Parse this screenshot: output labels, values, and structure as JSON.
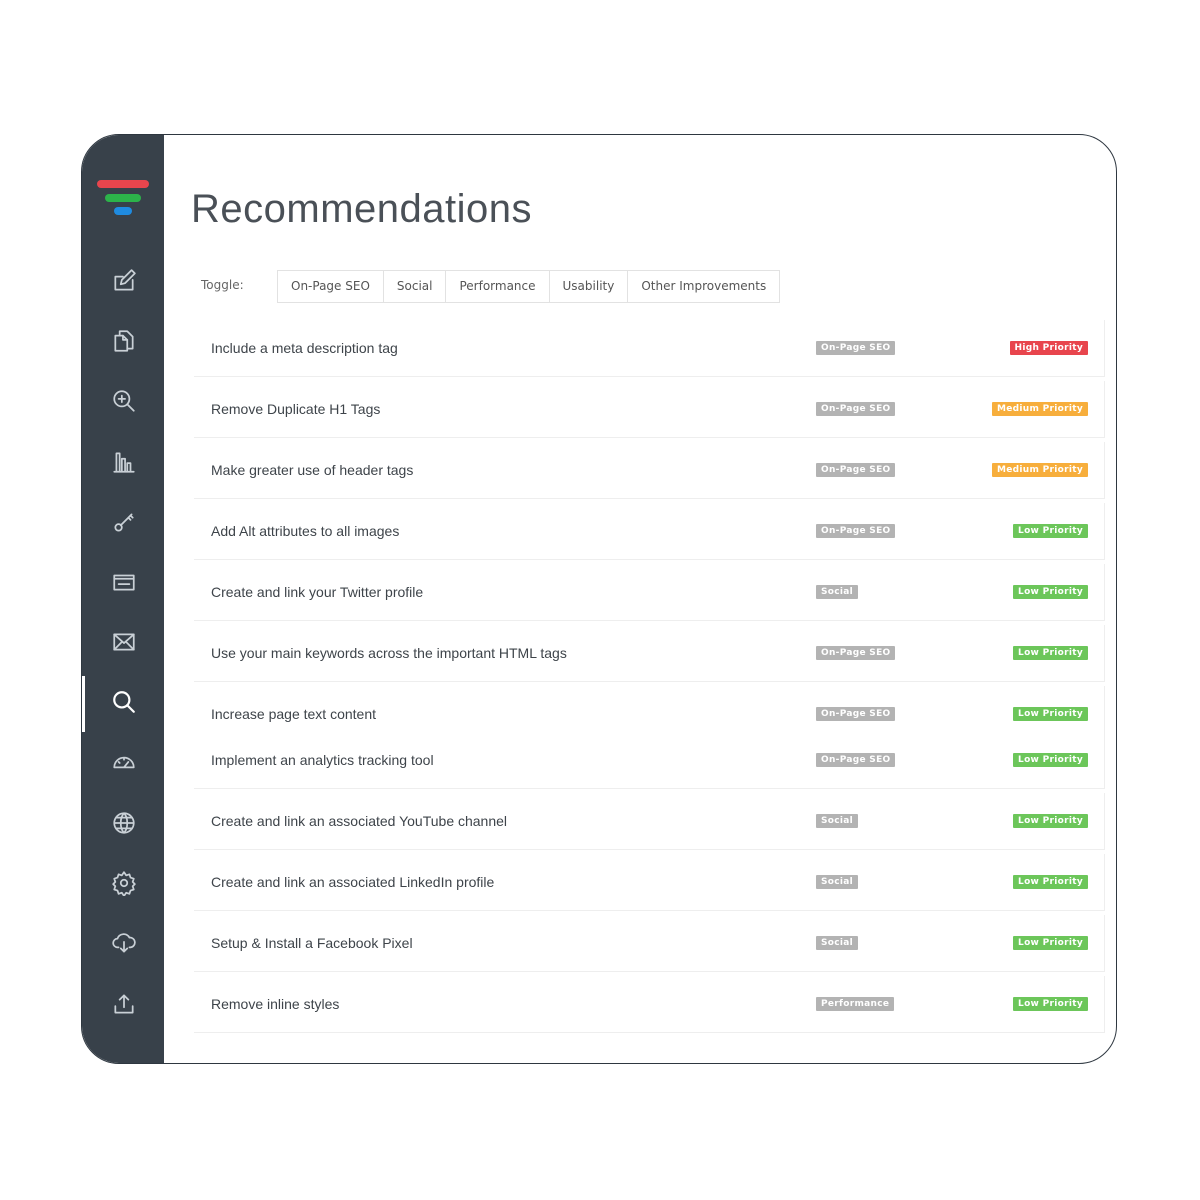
{
  "colors": {
    "sidebar_bg": "#38414a",
    "logo_red": "#e8454d",
    "logo_green": "#2cb34a",
    "logo_blue": "#1f8be0",
    "high_priority": "#e8454d",
    "medium_priority": "#f7ae3c",
    "low_priority": "#6cc65a",
    "category": "#b3b3b3"
  },
  "sidebar": {
    "items": [
      {
        "icon": "edit-icon"
      },
      {
        "icon": "documents-icon"
      },
      {
        "icon": "zoom-in-icon"
      },
      {
        "icon": "bar-chart-icon"
      },
      {
        "icon": "key-icon"
      },
      {
        "icon": "inbox-icon"
      },
      {
        "icon": "mail-icon"
      },
      {
        "icon": "search-icon",
        "active": true
      },
      {
        "icon": "speedometer-icon"
      },
      {
        "icon": "globe-icon"
      },
      {
        "icon": "settings-icon"
      },
      {
        "icon": "cloud-download-icon"
      },
      {
        "icon": "upload-icon"
      }
    ]
  },
  "main": {
    "title": "Recommendations",
    "toggle_label": "Toggle:",
    "tabs": [
      "On-Page SEO",
      "Social",
      "Performance",
      "Usability",
      "Other Improvements"
    ]
  },
  "recommendations": [
    {
      "label": "Include a meta description tag",
      "category": "On-Page SEO",
      "priority": "High Priority",
      "level": "high"
    },
    {
      "label": "Remove Duplicate H1 Tags",
      "category": "On-Page SEO",
      "priority": "Medium Priority",
      "level": "medium"
    },
    {
      "label": "Make greater use of header tags",
      "category": "On-Page SEO",
      "priority": "Medium Priority",
      "level": "medium"
    },
    {
      "label": "Add Alt attributes to all images",
      "category": "On-Page SEO",
      "priority": "Low Priority",
      "level": "low"
    },
    {
      "label": "Create and link your Twitter profile",
      "category": "Social",
      "priority": "Low Priority",
      "level": "low"
    },
    {
      "label": "Use your main keywords across the important HTML tags",
      "category": "On-Page SEO",
      "priority": "Low Priority",
      "level": "low"
    },
    {
      "label": "Increase page text content",
      "category": "On-Page SEO",
      "priority": "Low Priority",
      "level": "low"
    },
    {
      "label": "Implement an analytics tracking tool",
      "category": "On-Page SEO",
      "priority": "Low Priority",
      "level": "low"
    },
    {
      "label": "Create and link an associated YouTube channel",
      "category": "Social",
      "priority": "Low Priority",
      "level": "low"
    },
    {
      "label": "Create and link an associated LinkedIn profile",
      "category": "Social",
      "priority": "Low Priority",
      "level": "low"
    },
    {
      "label": "Setup & Install a Facebook Pixel",
      "category": "Social",
      "priority": "Low Priority",
      "level": "low"
    },
    {
      "label": "Remove inline styles",
      "category": "Performance",
      "priority": "Low Priority",
      "level": "low"
    }
  ]
}
